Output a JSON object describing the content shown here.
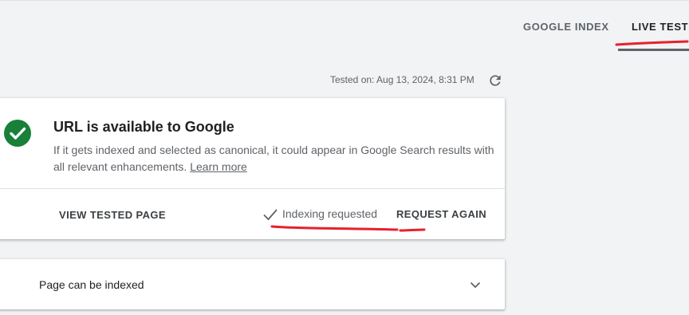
{
  "tabs": [
    {
      "label": "GOOGLE INDEX",
      "active": false
    },
    {
      "label": "LIVE TEST",
      "active": true
    }
  ],
  "tested_on": "Tested on: Aug 13, 2024, 8:31 PM",
  "status_card": {
    "icon": "check-circle-icon",
    "title": "URL is available to Google",
    "description": "If it gets indexed and selected as canonical, it could appear in Google Search results with all relevant enhancements.",
    "learn_more": "Learn more",
    "view_tested_page": "VIEW TESTED PAGE",
    "indexing_status": "Indexing requested",
    "request_again": "REQUEST AGAIN"
  },
  "indexed_card": {
    "label": "Page can be indexed",
    "icon": "chevron-down-icon"
  },
  "colors": {
    "success": "#188038",
    "annotation": "#e8202e",
    "background": "#f1f3f4"
  }
}
